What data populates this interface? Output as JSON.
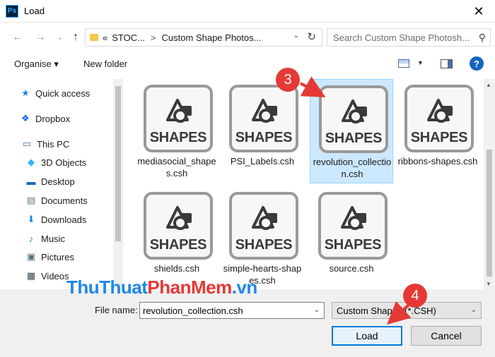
{
  "window": {
    "app_icon": "Ps",
    "title": "Load",
    "close_glyph": "✕"
  },
  "nav": {
    "back_glyph": "←",
    "forward_glyph": "→",
    "up_glyph": "↑",
    "address_prefix": "«",
    "address_segments": [
      "STOC...",
      "Custom Shape Photos..."
    ],
    "address_sep": ">",
    "refresh_glyph": "↻",
    "dropdown_glyph": "⌄",
    "search_placeholder": "Search Custom Shape Photosh...",
    "search_glyph": "⚲"
  },
  "toolbar": {
    "organise_label": "Organise ▾",
    "new_folder_label": "New folder",
    "view_dd_glyph": "▼",
    "help_label": "?"
  },
  "sidebar": {
    "items": [
      {
        "label": "Quick access",
        "icon": "star-icon",
        "glyph": "★",
        "color": "#1e88e5"
      },
      {
        "label": "Dropbox",
        "icon": "dropbox-icon",
        "glyph": "❖",
        "color": "#0061ff"
      },
      {
        "label": "This PC",
        "icon": "computer-icon",
        "glyph": "▭",
        "color": "#4a6fa5"
      },
      {
        "label": "3D Objects",
        "icon": "cube-icon",
        "glyph": "◆",
        "color": "#29b6f6"
      },
      {
        "label": "Desktop",
        "icon": "desktop-icon",
        "glyph": "▬",
        "color": "#1565c0"
      },
      {
        "label": "Documents",
        "icon": "document-icon",
        "glyph": "▤",
        "color": "#607d8b"
      },
      {
        "label": "Downloads",
        "icon": "download-icon",
        "glyph": "⬇",
        "color": "#1e88e5"
      },
      {
        "label": "Music",
        "icon": "music-icon",
        "glyph": "♪",
        "color": "#1e88e5"
      },
      {
        "label": "Pictures",
        "icon": "pictures-icon",
        "glyph": "▣",
        "color": "#546e7a"
      },
      {
        "label": "Videos",
        "icon": "video-icon",
        "glyph": "▦",
        "color": "#37474f"
      }
    ]
  },
  "files": {
    "icon_word": "SHAPES",
    "items": [
      {
        "name": "mediasocial_shapes.csh",
        "selected": false
      },
      {
        "name": "PSI_Labels.csh",
        "selected": false
      },
      {
        "name": "revolution_collection.csh",
        "selected": true
      },
      {
        "name": "ribbons-shapes.csh",
        "selected": false
      },
      {
        "name": "shields.csh",
        "selected": false
      },
      {
        "name": "simple-hearts-shapes.csh",
        "selected": false
      },
      {
        "name": "source.csh",
        "selected": false
      }
    ]
  },
  "footer": {
    "file_name_label": "File name:",
    "file_name_value": "revolution_collection.csh",
    "file_type_value": "Custom Shapes (*.CSH)",
    "load_label": "Load",
    "cancel_label": "Cancel",
    "dropdown_glyph": "⌄"
  },
  "annotations": {
    "step3": "3",
    "step4": "4",
    "accent_color": "#e53935"
  },
  "watermark": {
    "part1": "ThuThuat",
    "part2": "PhanMem",
    "part3": ".vn"
  }
}
